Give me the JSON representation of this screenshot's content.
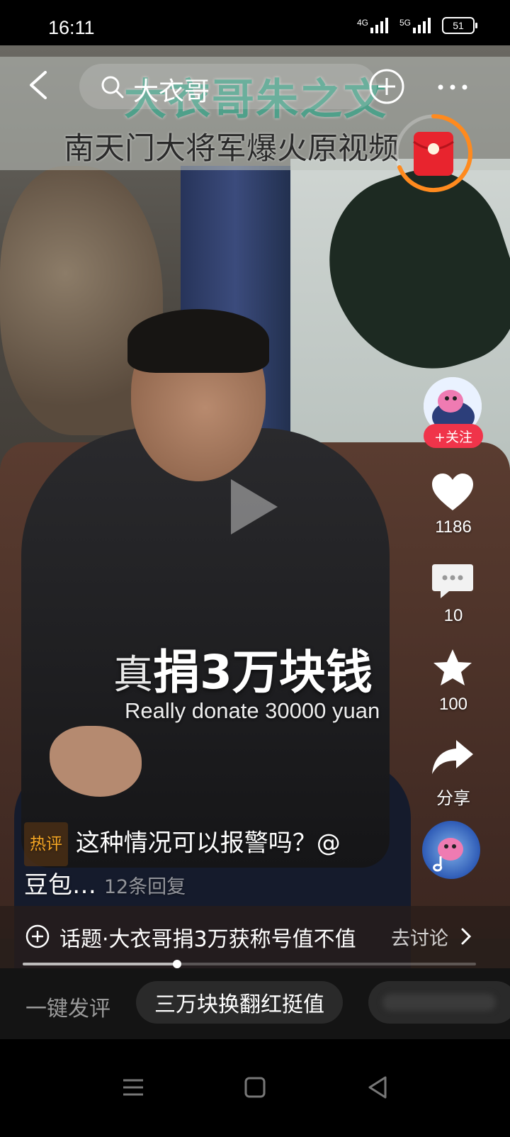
{
  "status_bar": {
    "time": "16:11",
    "network1": "4G",
    "network2": "5G",
    "battery": "51"
  },
  "video": {
    "overlay_title_line1": "大衣哥朱之文",
    "overlay_title_line2": "南天门大将军爆火原视频",
    "subtitle_prefix": "真",
    "subtitle_main": "捐3万块钱",
    "subtitle_english": "Really donate 30000 yuan"
  },
  "top_nav": {
    "search_text": "大衣哥"
  },
  "creator": {
    "follow_label": "+关注"
  },
  "actions": {
    "likes": "1186",
    "comments": "10",
    "favorites": "100",
    "share_label": "分享"
  },
  "hot_comment": {
    "badge": "热评",
    "text_line1": "这种情况可以报警吗？@",
    "text_line2": "豆包…",
    "reply_count": "12条回复"
  },
  "topic": {
    "text": "话题·大衣哥捐3万获称号值不值",
    "action": "去讨论"
  },
  "playback": {
    "progress_fraction": 0.34
  },
  "quick_comment": {
    "label": "一键发评",
    "chip1": "三万块换翻红挺值"
  },
  "colors": {
    "follow_red": "#f0344a",
    "title_teal": "#4fa08a",
    "hot_badge_orange": "#f5a623",
    "redpacket_orange": "#ff8a1e"
  }
}
